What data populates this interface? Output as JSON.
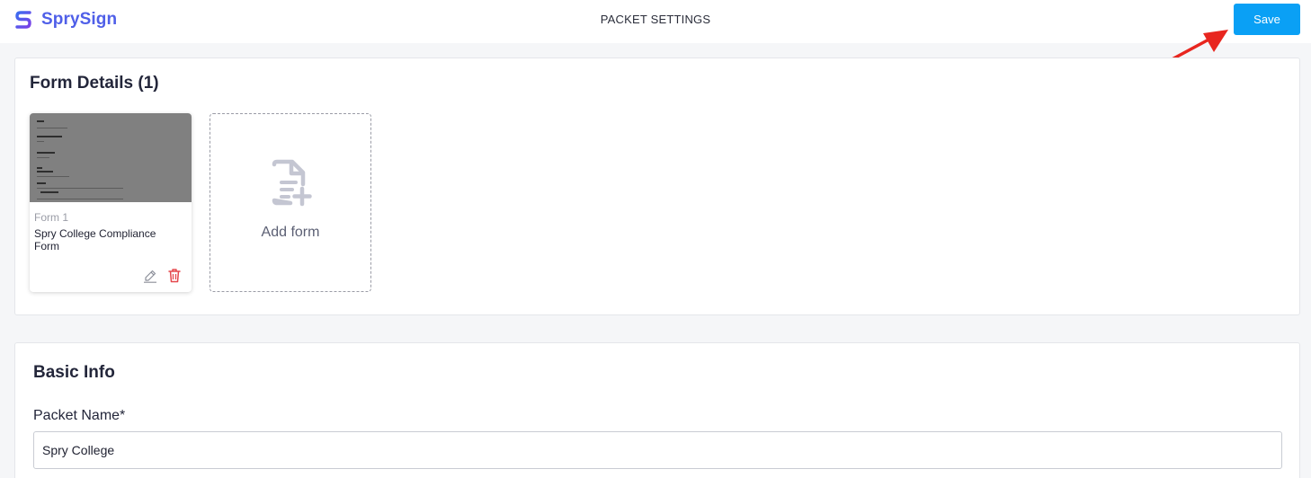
{
  "header": {
    "brand": "SprySign",
    "title": "PACKET SETTINGS",
    "save_label": "Save"
  },
  "form_details": {
    "title": "Form Details (1)",
    "forms": [
      {
        "number": "Form 1",
        "name": "Spry College Compliance Form"
      }
    ],
    "add_form_label": "Add form"
  },
  "basic_info": {
    "title": "Basic Info",
    "packet_name_label": "Packet Name*",
    "packet_name_value": "Spry College"
  },
  "colors": {
    "brand": "#4f5fe8",
    "primary_button": "#0aa0f5",
    "delete": "#e5484d",
    "annotation_arrow": "#e8261f"
  },
  "icons": [
    "sprysign-logo-icon",
    "pencil-icon",
    "trash-icon",
    "file-add-icon",
    "annotation-arrow"
  ]
}
